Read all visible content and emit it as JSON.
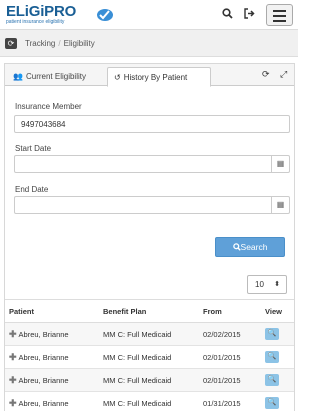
{
  "app": {
    "logo_text": "ELiGiPRO",
    "logo_tagline": "patient insurance eligibility"
  },
  "topbar": {
    "search_icon": "search-icon",
    "logout_icon": "sign-out-icon",
    "menu_icon": "hamburger-icon"
  },
  "breadcrumb": {
    "items": [
      "Tracking",
      "Eligibility"
    ],
    "separator": "/"
  },
  "tabs": [
    {
      "label": "Current Eligibility",
      "icon": "users-icon",
      "active": false
    },
    {
      "label": "History By Patient",
      "icon": "history-icon",
      "active": true
    }
  ],
  "form": {
    "member_label": "Insurance Member",
    "member_value": "9497043684",
    "start_label": "Start Date",
    "start_value": "",
    "end_label": "End Date",
    "end_value": "",
    "search_label": "Search"
  },
  "pagination": {
    "page_size": "10"
  },
  "table": {
    "headers": [
      "Patient",
      "Benefit Plan",
      "From",
      "View"
    ],
    "rows": [
      {
        "patient": "Abreu, Brianne",
        "plan": "MM C: Full Medicaid",
        "from": "02/02/2015"
      },
      {
        "patient": "Abreu, Brianne",
        "plan": "MM C: Full Medicaid",
        "from": "02/01/2015"
      },
      {
        "patient": "Abreu, Brianne",
        "plan": "MM C: Full Medicaid",
        "from": "02/01/2015"
      },
      {
        "patient": "Abreu, Brianne",
        "plan": "MM C: Full Medicaid",
        "from": "01/31/2015"
      }
    ]
  },
  "colors": {
    "brand": "#1a5f95",
    "accent": "#5fa0d8",
    "view_button": "#8cc3e6"
  }
}
